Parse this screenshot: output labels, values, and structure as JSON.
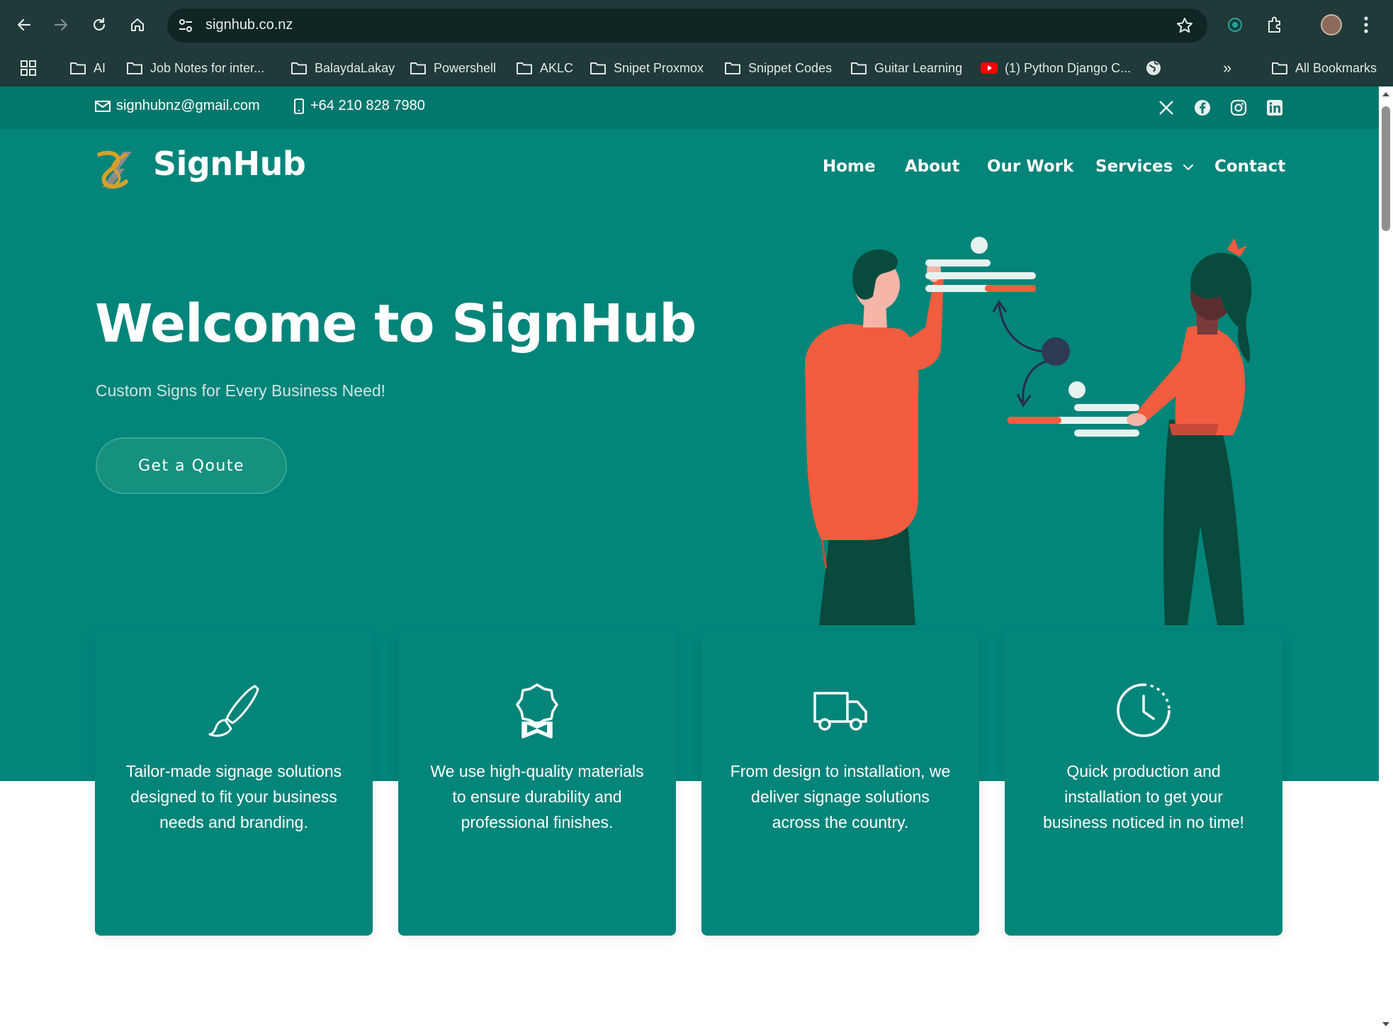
{
  "browser": {
    "url": "signhub.co.nz",
    "bookmarks": [
      {
        "label": "AI",
        "type": "folder"
      },
      {
        "label": "Job Notes for inter...",
        "type": "folder"
      },
      {
        "label": "BalaydaLakay",
        "type": "folder"
      },
      {
        "label": "Powershell",
        "type": "folder"
      },
      {
        "label": "AKLC",
        "type": "folder"
      },
      {
        "label": "Snipet Proxmox",
        "type": "folder"
      },
      {
        "label": "Snippet Codes",
        "type": "folder"
      },
      {
        "label": "Guitar Learning",
        "type": "folder"
      },
      {
        "label": "(1) Python Django C...",
        "type": "youtube"
      }
    ],
    "all_bookmarks": "All Bookmarks",
    "overflow": "»"
  },
  "topbar": {
    "email": "signhubnz@gmail.com",
    "phone": "+64 210 828 7980",
    "social_icons": [
      "x-icon",
      "facebook-icon",
      "instagram-icon",
      "linkedin-icon"
    ]
  },
  "site": {
    "brand": "SignHub",
    "nav": [
      "Home",
      "About",
      "Our Work",
      "Services",
      "Contact"
    ]
  },
  "hero": {
    "title": "Welcome to SignHub",
    "subtitle": "Custom Signs for Every Business Need!",
    "cta": "Get a Qoute"
  },
  "features": [
    {
      "icon": "paintbrush-icon",
      "text": "Tailor-made signage solutions designed to fit your business needs and branding."
    },
    {
      "icon": "award-ribbon-icon",
      "text": "We use high-quality materials to ensure durability and professional finishes."
    },
    {
      "icon": "delivery-truck-icon",
      "text": "From design to installation, we deliver signage solutions across the country."
    },
    {
      "icon": "clock-icon",
      "text": "Quick production and installation to get your business noticed in no time!"
    }
  ],
  "colors": {
    "teal": "#03857a",
    "teal_dark": "#02776c",
    "illustration_orange": "#f25c3f",
    "illustration_dark_green": "#084a3c",
    "logo_gold": "#d4a12a"
  }
}
